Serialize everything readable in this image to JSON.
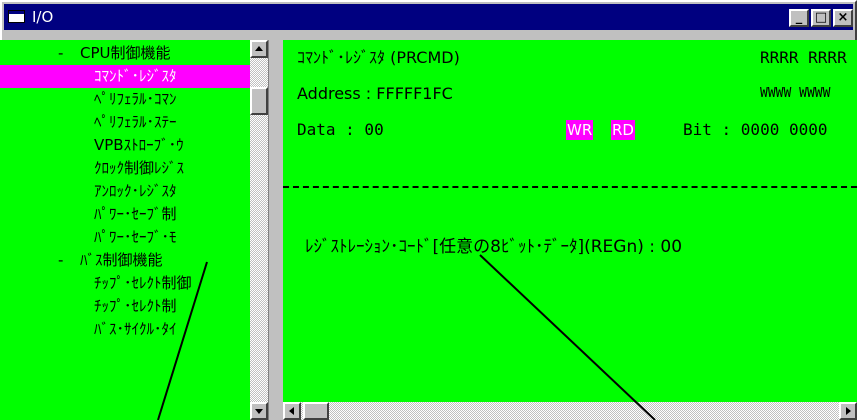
{
  "window": {
    "title": "I/O",
    "buttons": {
      "minimize": "_",
      "maximize": "□",
      "close": "×"
    }
  },
  "tree": {
    "items": [
      {
        "label": "CPU制御機能",
        "bullet": "-",
        "level": 0,
        "selected": false
      },
      {
        "label": "ｺﾏﾝﾄﾞ･ﾚｼﾞｽﾀ",
        "level": 1,
        "selected": true
      },
      {
        "label": "ﾍﾟﾘﾌｪﾗﾙ･ｺﾏﾝ",
        "level": 1,
        "selected": false
      },
      {
        "label": "ﾍﾟﾘﾌｪﾗﾙ･ｽﾃｰ",
        "level": 1,
        "selected": false
      },
      {
        "label": "VPBｽﾄﾛｰﾌﾞ･ｳ",
        "level": 1,
        "selected": false
      },
      {
        "label": "ｸﾛｯｸ制御ﾚｼﾞｽ",
        "level": 1,
        "selected": false
      },
      {
        "label": "ｱﾝﾛｯｸ･ﾚｼﾞｽﾀ",
        "level": 1,
        "selected": false
      },
      {
        "label": "ﾊﾟﾜｰ･ｾｰﾌﾞ制",
        "level": 1,
        "selected": false
      },
      {
        "label": "ﾊﾟﾜｰ･ｾｰﾌﾞ･ﾓ",
        "level": 1,
        "selected": false
      },
      {
        "label": "ﾊﾞｽ制御機能",
        "bullet": "-",
        "level": 0,
        "selected": false
      },
      {
        "label": "ﾁｯﾌﾟ･ｾﾚｸﾄ制御",
        "level": 1,
        "selected": false
      },
      {
        "label": "ﾁｯﾌﾟ･ｾﾚｸﾄ制",
        "level": 1,
        "selected": false
      },
      {
        "label": "ﾊﾞｽ･ｻｲｸﾙ･ﾀｲ",
        "level": 1,
        "selected": false
      }
    ]
  },
  "register": {
    "name": "ｺﾏﾝﾄﾞ･ﾚｼﾞｽﾀ (PRCMD)",
    "access_header": "RRRR RRRR",
    "address_label": "Address : FFFFF1FC",
    "write_header": "WWWW WWWW",
    "data_label": "Data   : 00",
    "wr_badge": "WR",
    "rd_badge": "RD",
    "bit_label": "Bit : 0000 0000",
    "field_label": "ﾚｼﾞｽﾄﾚｰｼｮﾝ･ｺｰﾄﾞ[任意の8ﾋﾞｯﾄ･ﾃﾞｰﾀ](REGn) : 00"
  },
  "colors": {
    "pane_bg": "#00ff00",
    "selection_bg": "#ff00ff",
    "title_bg": "#000080",
    "chrome": "#c0c0c0"
  }
}
